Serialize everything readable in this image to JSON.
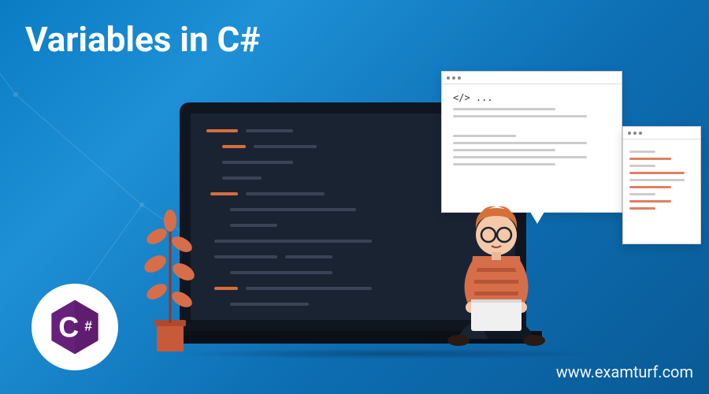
{
  "title": "Variables in C#",
  "watermark": "www.examturf.com",
  "logo": {
    "text": "C",
    "symbol": "#"
  },
  "popup_main": {
    "code_symbol": "</>",
    "ellipsis": "..."
  },
  "colors": {
    "bg_primary": "#1e90d6",
    "accent_orange": "#d66e3a",
    "laptop_screen": "#1a2332",
    "csharp_purple": "#68217a"
  }
}
